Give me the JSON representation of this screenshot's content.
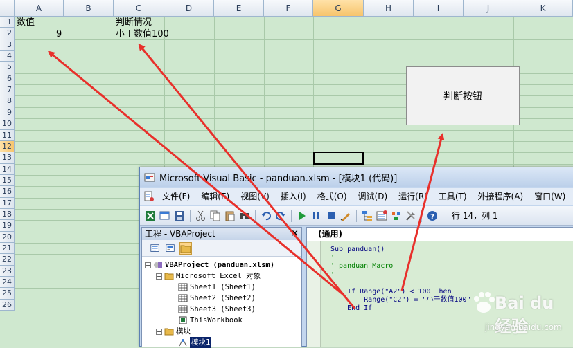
{
  "sheet": {
    "columns": [
      "A",
      "B",
      "C",
      "D",
      "E",
      "F",
      "G",
      "H",
      "I",
      "J",
      "K"
    ],
    "selected_column": "G",
    "rows": [
      "1",
      "2",
      "3",
      "4",
      "5",
      "6",
      "7",
      "8",
      "9",
      "10",
      "11",
      "12",
      "13",
      "14",
      "15",
      "16",
      "17",
      "18",
      "19",
      "20",
      "21",
      "22",
      "23",
      "24",
      "25",
      "26"
    ],
    "selected_row": "12",
    "cells": {
      "a1": "数值",
      "c1": "判断情况",
      "a2": "9",
      "c2": "小于数值100"
    },
    "button_label": "判断按钮"
  },
  "vbe": {
    "title": "Microsoft Visual Basic - panduan.xlsm - [模块1 (代码)]",
    "menu": [
      "文件(F)",
      "编辑(E)",
      "视图(V)",
      "插入(I)",
      "格式(O)",
      "调试(D)",
      "运行(R)",
      "工具(T)",
      "外接程序(A)",
      "窗口(W)"
    ],
    "cursor_position": "行 14，列 1",
    "project_pane": {
      "title": "工程 - VBAProject",
      "close": "×",
      "tree": [
        {
          "label": "VBAProject (panduan.xlsm)",
          "toggle": "−"
        },
        {
          "label": "Microsoft Excel 对象",
          "toggle": "−"
        },
        {
          "label": "Sheet1 (Sheet1)"
        },
        {
          "label": "Sheet2 (Sheet2)"
        },
        {
          "label": "Sheet3 (Sheet3)"
        },
        {
          "label": "ThisWorkbook"
        },
        {
          "label": "模块",
          "toggle": "−"
        },
        {
          "label": "模块1"
        }
      ]
    },
    "code_pane": {
      "object_combo": "(通用)",
      "lines": [
        "Sub panduan()",
        "'",
        "' panduan Macro",
        "'",
        "",
        "'",
        "    If Range(\"A2\") < 100 Then",
        "        Range(\"C2\") = \"小于数值100\"",
        "    End If"
      ]
    }
  },
  "watermark": {
    "brand": "Bai du 经验",
    "url": "jingyan.baidu.com"
  },
  "colors": {
    "sheet_bg": "#cfe8cf",
    "arrow": "#e8302b",
    "code_bg": "#d8ecd4"
  }
}
